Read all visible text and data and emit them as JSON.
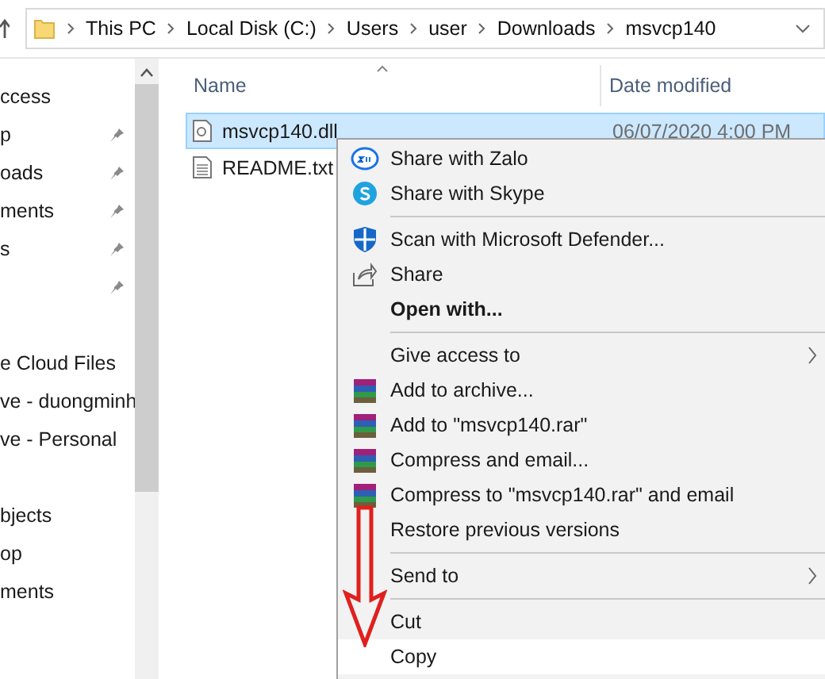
{
  "address_bar": {
    "path": [
      "This PC",
      "Local Disk (C:)",
      "Users",
      "user",
      "Downloads",
      "msvcp140"
    ]
  },
  "nav_pane": {
    "groups": [
      [
        {
          "label": "ccess",
          "pinned": false
        },
        {
          "label": "p",
          "pinned": true
        },
        {
          "label": "oads",
          "pinned": true
        },
        {
          "label": "ments",
          "pinned": true
        },
        {
          "label": "s",
          "pinned": true
        },
        {
          "pinned": true
        }
      ],
      [
        {
          "label": "e Cloud Files",
          "pinned": false
        },
        {
          "label": "ve - duongminh",
          "pinned": false
        },
        {
          "label": "ve - Personal",
          "pinned": false
        }
      ],
      [
        {
          "label": "bjects",
          "pinned": false
        },
        {
          "label": "op",
          "pinned": false
        },
        {
          "label": "ments",
          "pinned": false
        }
      ]
    ]
  },
  "file_list": {
    "columns": [
      "Name",
      "Date modified"
    ],
    "rows": [
      {
        "name": "msvcp140.dll",
        "kind": "dll",
        "date": "06/07/2020 4:00 PM",
        "selected": true
      },
      {
        "name": "README.txt",
        "kind": "txt",
        "selected": false
      }
    ]
  },
  "context_menu": {
    "items": [
      {
        "kind": "item",
        "label": "Share with Zalo",
        "bold": false,
        "submenu": false,
        "selected": false
      },
      {
        "kind": "item",
        "label": "Share with Skype",
        "bold": false,
        "submenu": false,
        "selected": false
      },
      {
        "kind": "separator"
      },
      {
        "kind": "item",
        "label": "Scan with Microsoft Defender...",
        "bold": false,
        "submenu": false,
        "selected": false
      },
      {
        "kind": "item",
        "label": "Share",
        "bold": false,
        "submenu": false,
        "selected": false
      },
      {
        "kind": "item",
        "label": "Open with...",
        "bold": true,
        "submenu": false,
        "selected": false
      },
      {
        "kind": "separator"
      },
      {
        "kind": "item",
        "label": "Give access to",
        "bold": false,
        "submenu": true,
        "selected": false
      },
      {
        "kind": "item",
        "label": "Add to archive...",
        "bold": false,
        "submenu": false,
        "selected": false
      },
      {
        "kind": "item",
        "label": "Add to \"msvcp140.rar\"",
        "bold": false,
        "submenu": false,
        "selected": false
      },
      {
        "kind": "item",
        "label": "Compress and email...",
        "bold": false,
        "submenu": false,
        "selected": false
      },
      {
        "kind": "item",
        "label": "Compress to \"msvcp140.rar\" and email",
        "bold": false,
        "submenu": false,
        "selected": false
      },
      {
        "kind": "item",
        "label": "Restore previous versions",
        "bold": false,
        "submenu": false,
        "selected": false
      },
      {
        "kind": "separator"
      },
      {
        "kind": "item",
        "label": "Send to",
        "bold": false,
        "submenu": true,
        "selected": false
      },
      {
        "kind": "separator"
      },
      {
        "kind": "item",
        "label": "Cut",
        "bold": false,
        "submenu": false,
        "selected": false
      },
      {
        "kind": "item",
        "label": "Copy",
        "bold": false,
        "submenu": false,
        "selected": true
      }
    ]
  }
}
